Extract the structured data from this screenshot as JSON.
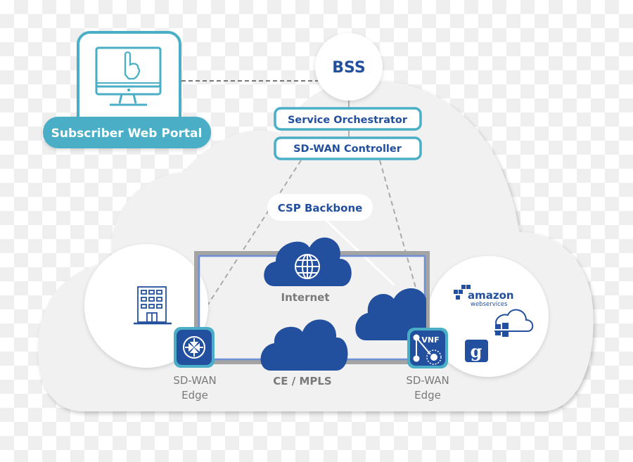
{
  "diagram": {
    "portal": {
      "label": "Subscriber Web Portal",
      "icon": "monitor-pointer-icon"
    },
    "bss": {
      "label": "BSS"
    },
    "service_orchestrator": {
      "label": "Service Orchestrator"
    },
    "sdwan_controller": {
      "label": "SD-WAN Controller"
    },
    "backbone": {
      "label": "CSP Backbone"
    },
    "internet": {
      "label": "Internet",
      "icon": "globe-icon"
    },
    "mpls": {
      "label": "CE / MPLS"
    },
    "edge_left": {
      "line1": "SD-WAN",
      "line2": "Edge",
      "icon": "router-icon"
    },
    "edge_right": {
      "line1": "SD-WAN",
      "line2": "Edge",
      "icon": "vnf-icon",
      "badge": "VNF"
    },
    "branch": {
      "icon": "building-icon"
    },
    "cloud_providers": {
      "amazon": {
        "line1": "amazon",
        "line2": "webservices"
      },
      "icons": [
        "aws-logo-icon",
        "azure-cloud-icon",
        "google-icon"
      ]
    },
    "colors": {
      "teal": "#4aaec6",
      "navy": "#23509e",
      "cloud_bg": "#f1f1f1",
      "label_grey": "#7a7a7a",
      "dash": "#9a9a9a"
    }
  }
}
